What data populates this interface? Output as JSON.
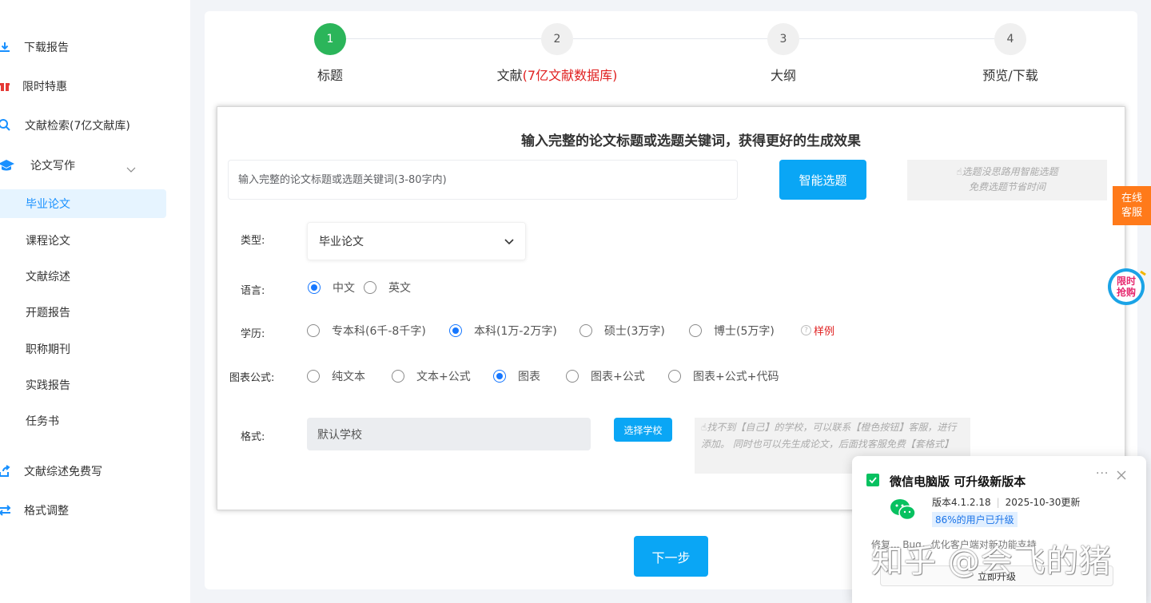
{
  "sidebar": {
    "items": [
      {
        "label": "下载报告",
        "icon": "download-icon"
      },
      {
        "label": "限时特惠",
        "icon": "gift-icon"
      },
      {
        "label": "文献检索(7亿文献库)",
        "icon": "search-icon"
      },
      {
        "label": "论文写作",
        "icon": "graduation-cap-icon"
      }
    ],
    "sub_items": [
      "毕业论文",
      "课程论文",
      "文献综述",
      "开题报告",
      "职称期刊",
      "实践报告",
      "任务书"
    ],
    "bottom_items": [
      {
        "label": "文献综述免费写",
        "icon": "share-icon"
      },
      {
        "label": "格式调整",
        "icon": "swap-icon"
      }
    ]
  },
  "steps": [
    {
      "number": "1",
      "label": "标题"
    },
    {
      "number": "2",
      "label": "文献",
      "label_highlight": "(7亿文献数据库)"
    },
    {
      "number": "3",
      "label": "大纲"
    },
    {
      "number": "4",
      "label": "预览/下载"
    }
  ],
  "form": {
    "title": "输入完整的论文标题或选题关键词，获得更好的生成效果",
    "title_placeholder": "输入完整的论文标题或选题关键词(3-80字内)",
    "smart_button": "智能选题",
    "hint_line1": "选题没思路用智能选题",
    "hint_line2": "免费选题节省时间",
    "type_label": "类型:",
    "type_value": "毕业论文",
    "language_label": "语言:",
    "language_options": [
      "中文",
      "英文"
    ],
    "education_label": "学历:",
    "education_options": [
      "专本科(6千-8千字)",
      "本科(1万-2万字)",
      "硕士(3万字)",
      "博士(5万字)"
    ],
    "sample_link": "样例",
    "chart_label": "图表公式:",
    "chart_options": [
      "纯文本",
      "文本+公式",
      "图表",
      "图表+公式",
      "图表+公式+代码"
    ],
    "format_label": "格式:",
    "school_value": "默认学校",
    "school_button": "选择学校",
    "format_hint": "找不到【自己】的学校，可以联系【橙色按钮】客服，进行添加。 同时也可以先生成论文，后面找客服免费【套格式】",
    "next_button": "下一步"
  },
  "floating": {
    "cs_line1": "在线",
    "cs_line2": "客服",
    "promo_line1": "限时",
    "promo_line2": "抢购"
  },
  "wechat_popup": {
    "title": "微信电脑版 可升级新版本",
    "more": "···",
    "version": "版本4.1.2.18",
    "date": "2025-10-30更新",
    "badge": "86%的用户已升级",
    "note": "修复... Bug，优化客户端对新功能支持",
    "upgrade_button": "立即升级"
  },
  "watermark": "知乎 @会飞的猪",
  "colors": {
    "accent": "#0aa6f5",
    "step_done": "#2bb55a",
    "highlight_red": "#e02020",
    "cs_orange": "#ff7a1a"
  }
}
